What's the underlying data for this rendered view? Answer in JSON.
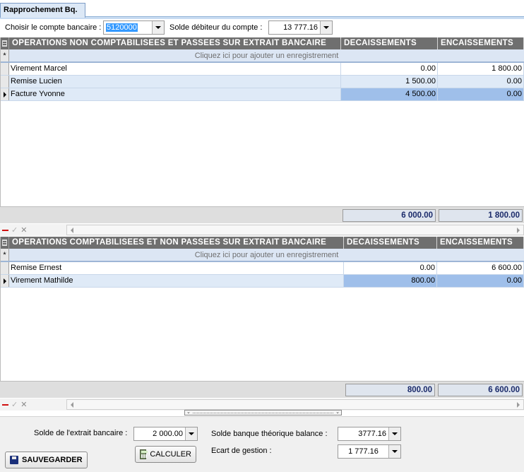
{
  "tab": {
    "label": "Rapprochement Bq."
  },
  "top": {
    "account_label": "Choisir le compte bancaire :",
    "account_value": "5120000",
    "balance_label": "Solde débiteur du compte :",
    "balance_value": "13 777.16"
  },
  "grid1": {
    "headers": [
      "OPERATIONS NON COMPTABILISEES ET PASSEES SUR EXTRAIT BANCAIRE",
      "DECAISSEMENTS",
      "ENCAISSEMENTS"
    ],
    "new_row_marker": "*",
    "new_row_hint": "Cliquez ici pour ajouter un enregistrement",
    "rows": [
      {
        "label": "Virement Marcel",
        "decaissement": "0.00",
        "encaissement": "1 800.00"
      },
      {
        "label": "Remise Lucien",
        "decaissement": "1 500.00",
        "encaissement": "0.00"
      },
      {
        "label": "Facture Yvonne",
        "decaissement": "4 500.00",
        "encaissement": "0.00"
      }
    ],
    "total_decaissements": "6 000.00",
    "total_encaissements": "1 800.00"
  },
  "grid2": {
    "headers": [
      "OPERATIONS COMPTABILISEES ET NON PASSEES SUR EXTRAIT BANCAIRE",
      "DECAISSEMENTS",
      "ENCAISSEMENTS"
    ],
    "new_row_marker": "*",
    "new_row_hint": "Cliquez ici pour ajouter un enregistrement",
    "rows": [
      {
        "label": "Remise Ernest",
        "decaissement": "0.00",
        "encaissement": "6 600.00"
      },
      {
        "label": "Virement Mathilde",
        "decaissement": "800.00",
        "encaissement": "0.00"
      }
    ],
    "total_decaissements": "800.00",
    "total_encaissements": "6 600.00"
  },
  "navigator": {
    "check_glyph": "✓",
    "x_glyph": "✕"
  },
  "splitter": {
    "left_chevron": "⌄",
    "right_chevron": "⌄"
  },
  "bottom": {
    "extrait_label": "Solde de l'extrait bancaire :",
    "extrait_value": "2 000.00",
    "theorique_label": "Solde banque théorique balance :",
    "theorique_value": "3777.16",
    "ecart_label": "Ecart de gestion :",
    "ecart_value": "1 777.16",
    "calculer_label": "CALCULER",
    "sauvegarder_label": "SAUVEGARDER"
  },
  "colors": {
    "header_bg": "#6f6f6f",
    "row_alt": "#dfeaf7",
    "row_current": "#9fbfea",
    "total_text": "#1a2a6a"
  }
}
